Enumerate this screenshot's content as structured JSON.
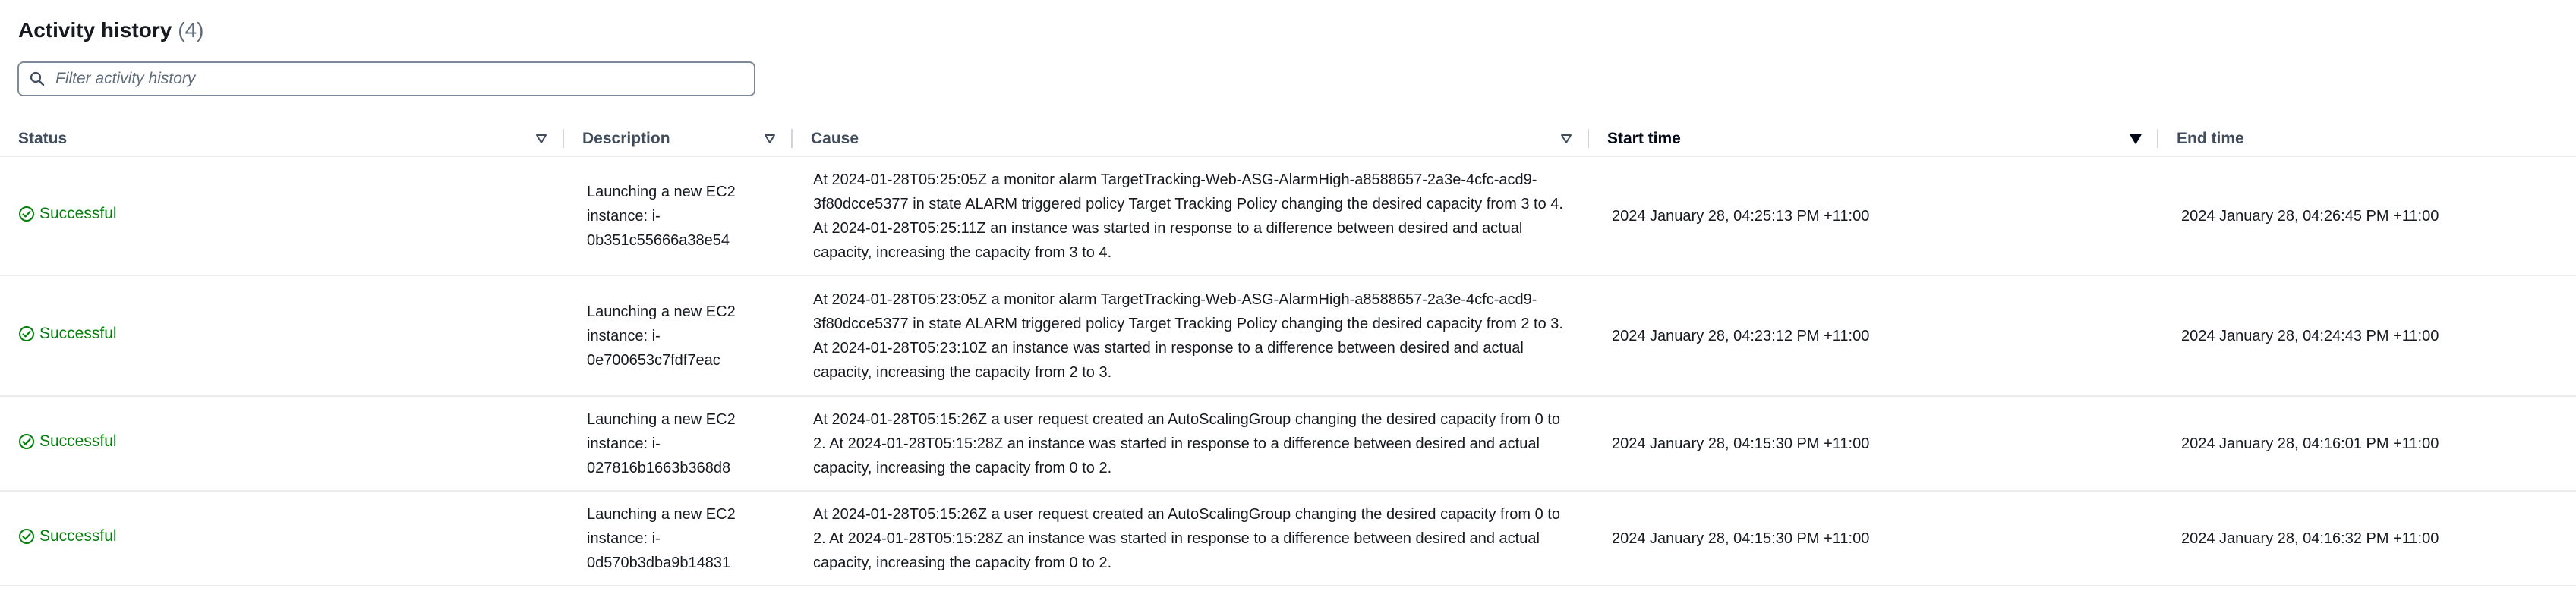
{
  "header": {
    "title": "Activity history",
    "count": "(4)"
  },
  "filter": {
    "placeholder": "Filter activity history",
    "icon": "search-icon"
  },
  "columns": {
    "status": "Status",
    "description": "Description",
    "cause": "Cause",
    "start_time": "Start time",
    "end_time": "End time"
  },
  "sorted_column": "start_time",
  "colors": {
    "success": "#037f0c",
    "header_text": "#414d5c",
    "divider": "#e9ebed"
  },
  "rows": [
    {
      "status": "Successful",
      "status_icon": "check-circle-icon",
      "description": "Launching a new EC2 instance: i-0b351c55666a38e54",
      "cause": "At 2024-01-28T05:25:05Z a monitor alarm TargetTracking-Web-ASG-AlarmHigh-a8588657-2a3e-4cfc-acd9-3f80dcce5377 in state ALARM triggered policy Target Tracking Policy changing the desired capacity from 3 to 4. At 2024-01-28T05:25:11Z an instance was started in response to a difference between desired and actual capacity, increasing the capacity from 3 to 4.",
      "start_time": "2024 January 28, 04:25:13 PM +11:00",
      "end_time": "2024 January 28, 04:26:45 PM +11:00"
    },
    {
      "status": "Successful",
      "status_icon": "check-circle-icon",
      "description": "Launching a new EC2 instance: i-0e700653c7fdf7eac",
      "cause": "At 2024-01-28T05:23:05Z a monitor alarm TargetTracking-Web-ASG-AlarmHigh-a8588657-2a3e-4cfc-acd9-3f80dcce5377 in state ALARM triggered policy Target Tracking Policy changing the desired capacity from 2 to 3. At 2024-01-28T05:23:10Z an instance was started in response to a difference between desired and actual capacity, increasing the capacity from 2 to 3.",
      "start_time": "2024 January 28, 04:23:12 PM +11:00",
      "end_time": "2024 January 28, 04:24:43 PM +11:00"
    },
    {
      "status": "Successful",
      "status_icon": "check-circle-icon",
      "description": "Launching a new EC2 instance: i-027816b1663b368d8",
      "cause": "At 2024-01-28T05:15:26Z a user request created an AutoScalingGroup changing the desired capacity from 0 to 2. At 2024-01-28T05:15:28Z an instance was started in response to a difference between desired and actual capacity, increasing the capacity from 0 to 2.",
      "start_time": "2024 January 28, 04:15:30 PM +11:00",
      "end_time": "2024 January 28, 04:16:01 PM +11:00"
    },
    {
      "status": "Successful",
      "status_icon": "check-circle-icon",
      "description": "Launching a new EC2 instance: i-0d570b3dba9b14831",
      "cause": "At 2024-01-28T05:15:26Z a user request created an AutoScalingGroup changing the desired capacity from 0 to 2. At 2024-01-28T05:15:28Z an instance was started in response to a difference between desired and actual capacity, increasing the capacity from 0 to 2.",
      "start_time": "2024 January 28, 04:15:30 PM +11:00",
      "end_time": "2024 January 28, 04:16:32 PM +11:00"
    }
  ]
}
